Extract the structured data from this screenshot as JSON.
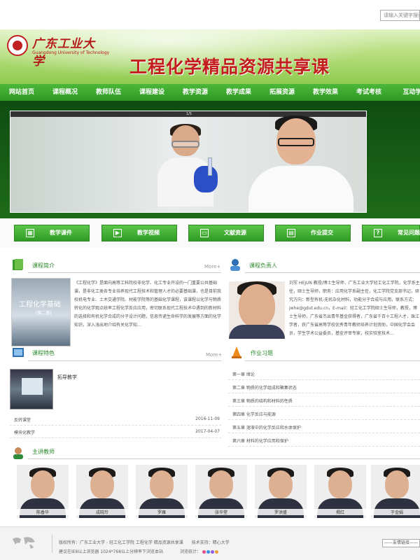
{
  "header": {
    "logo_cn": "广东工业大学",
    "logo_en": "Guangdong University of Technology",
    "title": "工程化学精品资源共享课",
    "search_placeholder": "请输入关键字搜索"
  },
  "nav": [
    "网站首页",
    "课程概况",
    "教师队伍",
    "课程建设",
    "教学资源",
    "教学成果",
    "拓展资源",
    "教学效果",
    "考试考核",
    "互动学"
  ],
  "slideshow": {
    "caption": "1/5"
  },
  "quick_links": [
    {
      "label": "教学课件",
      "icon": "grid-icon"
    },
    {
      "label": "教学视频",
      "icon": "video-icon"
    },
    {
      "label": "文献资源",
      "icon": "monitor-icon"
    },
    {
      "label": "作业提交",
      "icon": "upload-icon"
    },
    {
      "label": "常见问题",
      "icon": "question-icon"
    }
  ],
  "intro": {
    "title": "课程简介",
    "more": "More+",
    "book_title": "工程化学基础",
    "book_sub": "(第二版)",
    "text": "《工程化学》是面向高等工科院校非化学、化工专业开设的一门重要公共基础课，是非化工类各专业培养现代工程技术和管理人才的必要基础课，也是目前我校机电专业、土木交通学院、材能学院等的基础化学课程，该课程以化学与物质转化的化学观点统率工程化学反应应用，密切联系现代工程技术中遇到的新材料的选择和有机化学合成的分子设计问题，信息传递生命科学的发展等方面的化学知识，深入浅出地介绍有关化学知…"
  },
  "lead": {
    "title": "课程负责人",
    "text": "刘军 HEJUN 教授/博士生导师，广东工业大学轻工化工学院，化学系主任，硕士生导师，职务：应用化学系副主任，化工学院党支部书记，研究方向：新型有机-无机杂化材料，功能分子合成与应用，联系方式：jwhe@gdut.edu.cn，E-mail：轻工化工学院硕士生导师，教授，博士生导师，广东省杰出青年基金获得者，广东省千百十工程人才，珠江学者，获广东省高等学校优秀青年教师培养计划资助，中国化学会会员，学生学术公益委员，基金评审专家，校实验室技术…"
  },
  "feature": {
    "title": "课程特色",
    "more": "More+",
    "item": "拓导教学",
    "rows": [
      {
        "text": "反转课堂",
        "date": "2016-11-09"
      },
      {
        "text": "模块化教学",
        "date": "2017-04-07"
      }
    ]
  },
  "homework": {
    "title": "作业习题",
    "rows": [
      "第一章 绪论",
      "第二章 物质的化学组成和聚集状态",
      "第三章 物质的结构和材料的性质",
      "第四章 化学反应与能源",
      "第五章 溶液中的化学反应和水体保护",
      "第六章 材料的化学应用和保护"
    ]
  },
  "teachers": {
    "title": "主讲教师",
    "list": [
      "陈香华",
      "成晓玲",
      "罗雁",
      "张华堂",
      "罗洪盛",
      "揭红",
      "于金娟"
    ]
  },
  "footer": {
    "line1": "版权所有：广东工业大学 - 轻工化工学院 工程化学 精品资源共享课　　技术支持：精心大学",
    "line2": "建议在IE8以上浏览器 1024*768以上分辨率下浏览本站　　　　浏览统计：",
    "links": "——友情链接——"
  }
}
